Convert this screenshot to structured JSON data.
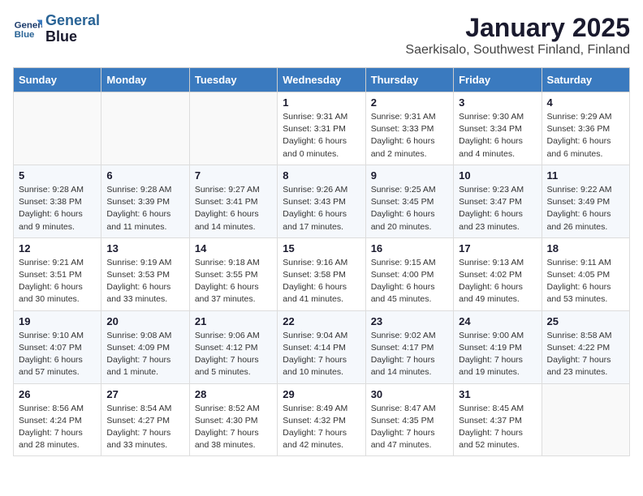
{
  "header": {
    "logo_line1": "General",
    "logo_line2": "Blue",
    "title": "January 2025",
    "subtitle": "Saerkisalo, Southwest Finland, Finland"
  },
  "weekdays": [
    "Sunday",
    "Monday",
    "Tuesday",
    "Wednesday",
    "Thursday",
    "Friday",
    "Saturday"
  ],
  "weeks": [
    [
      {
        "day": "",
        "info": ""
      },
      {
        "day": "",
        "info": ""
      },
      {
        "day": "",
        "info": ""
      },
      {
        "day": "1",
        "info": "Sunrise: 9:31 AM\nSunset: 3:31 PM\nDaylight: 6 hours\nand 0 minutes."
      },
      {
        "day": "2",
        "info": "Sunrise: 9:31 AM\nSunset: 3:33 PM\nDaylight: 6 hours\nand 2 minutes."
      },
      {
        "day": "3",
        "info": "Sunrise: 9:30 AM\nSunset: 3:34 PM\nDaylight: 6 hours\nand 4 minutes."
      },
      {
        "day": "4",
        "info": "Sunrise: 9:29 AM\nSunset: 3:36 PM\nDaylight: 6 hours\nand 6 minutes."
      }
    ],
    [
      {
        "day": "5",
        "info": "Sunrise: 9:28 AM\nSunset: 3:38 PM\nDaylight: 6 hours\nand 9 minutes."
      },
      {
        "day": "6",
        "info": "Sunrise: 9:28 AM\nSunset: 3:39 PM\nDaylight: 6 hours\nand 11 minutes."
      },
      {
        "day": "7",
        "info": "Sunrise: 9:27 AM\nSunset: 3:41 PM\nDaylight: 6 hours\nand 14 minutes."
      },
      {
        "day": "8",
        "info": "Sunrise: 9:26 AM\nSunset: 3:43 PM\nDaylight: 6 hours\nand 17 minutes."
      },
      {
        "day": "9",
        "info": "Sunrise: 9:25 AM\nSunset: 3:45 PM\nDaylight: 6 hours\nand 20 minutes."
      },
      {
        "day": "10",
        "info": "Sunrise: 9:23 AM\nSunset: 3:47 PM\nDaylight: 6 hours\nand 23 minutes."
      },
      {
        "day": "11",
        "info": "Sunrise: 9:22 AM\nSunset: 3:49 PM\nDaylight: 6 hours\nand 26 minutes."
      }
    ],
    [
      {
        "day": "12",
        "info": "Sunrise: 9:21 AM\nSunset: 3:51 PM\nDaylight: 6 hours\nand 30 minutes."
      },
      {
        "day": "13",
        "info": "Sunrise: 9:19 AM\nSunset: 3:53 PM\nDaylight: 6 hours\nand 33 minutes."
      },
      {
        "day": "14",
        "info": "Sunrise: 9:18 AM\nSunset: 3:55 PM\nDaylight: 6 hours\nand 37 minutes."
      },
      {
        "day": "15",
        "info": "Sunrise: 9:16 AM\nSunset: 3:58 PM\nDaylight: 6 hours\nand 41 minutes."
      },
      {
        "day": "16",
        "info": "Sunrise: 9:15 AM\nSunset: 4:00 PM\nDaylight: 6 hours\nand 45 minutes."
      },
      {
        "day": "17",
        "info": "Sunrise: 9:13 AM\nSunset: 4:02 PM\nDaylight: 6 hours\nand 49 minutes."
      },
      {
        "day": "18",
        "info": "Sunrise: 9:11 AM\nSunset: 4:05 PM\nDaylight: 6 hours\nand 53 minutes."
      }
    ],
    [
      {
        "day": "19",
        "info": "Sunrise: 9:10 AM\nSunset: 4:07 PM\nDaylight: 6 hours\nand 57 minutes."
      },
      {
        "day": "20",
        "info": "Sunrise: 9:08 AM\nSunset: 4:09 PM\nDaylight: 7 hours\nand 1 minute."
      },
      {
        "day": "21",
        "info": "Sunrise: 9:06 AM\nSunset: 4:12 PM\nDaylight: 7 hours\nand 5 minutes."
      },
      {
        "day": "22",
        "info": "Sunrise: 9:04 AM\nSunset: 4:14 PM\nDaylight: 7 hours\nand 10 minutes."
      },
      {
        "day": "23",
        "info": "Sunrise: 9:02 AM\nSunset: 4:17 PM\nDaylight: 7 hours\nand 14 minutes."
      },
      {
        "day": "24",
        "info": "Sunrise: 9:00 AM\nSunset: 4:19 PM\nDaylight: 7 hours\nand 19 minutes."
      },
      {
        "day": "25",
        "info": "Sunrise: 8:58 AM\nSunset: 4:22 PM\nDaylight: 7 hours\nand 23 minutes."
      }
    ],
    [
      {
        "day": "26",
        "info": "Sunrise: 8:56 AM\nSunset: 4:24 PM\nDaylight: 7 hours\nand 28 minutes."
      },
      {
        "day": "27",
        "info": "Sunrise: 8:54 AM\nSunset: 4:27 PM\nDaylight: 7 hours\nand 33 minutes."
      },
      {
        "day": "28",
        "info": "Sunrise: 8:52 AM\nSunset: 4:30 PM\nDaylight: 7 hours\nand 38 minutes."
      },
      {
        "day": "29",
        "info": "Sunrise: 8:49 AM\nSunset: 4:32 PM\nDaylight: 7 hours\nand 42 minutes."
      },
      {
        "day": "30",
        "info": "Sunrise: 8:47 AM\nSunset: 4:35 PM\nDaylight: 7 hours\nand 47 minutes."
      },
      {
        "day": "31",
        "info": "Sunrise: 8:45 AM\nSunset: 4:37 PM\nDaylight: 7 hours\nand 52 minutes."
      },
      {
        "day": "",
        "info": ""
      }
    ]
  ]
}
